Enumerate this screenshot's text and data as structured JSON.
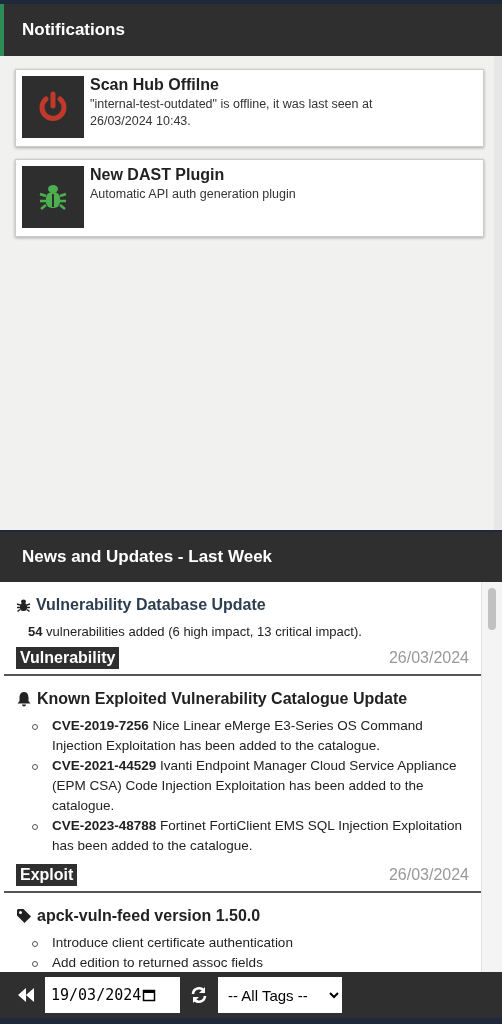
{
  "notifications": {
    "title": "Notifications",
    "items": [
      {
        "kind": "power",
        "title": "Scan Hub Offilne",
        "message": "\"internal-test-outdated\" is offline, it was last seen at 26/03/2024 10:43."
      },
      {
        "kind": "bug",
        "title": "New DAST Plugin",
        "message": "Automatic API auth generation plugin"
      }
    ]
  },
  "news": {
    "title": "News and Updates - Last Week",
    "items": [
      {
        "kind": "bug",
        "link": true,
        "title": "Vulnerability Database Update",
        "text": "**54** vulnerabilities added (6 high impact, 13 critical impact).",
        "tag": "Vulnerability",
        "date": "26/03/2024"
      },
      {
        "kind": "bell",
        "link": false,
        "title": "Known Exploited Vulnerability Catalogue Update",
        "bullets": [
          "**CVE-2019-7256** Nice Linear eMerge E3-Series OS Command Injection Exploitation has been added to the catalogue.",
          "**CVE-2021-44529** Ivanti Endpoint Manager Cloud Service Appliance (EPM CSA) Code Injection Exploitation has been added to the catalogue.",
          "**CVE-2023-48788** Fortinet FortiClient EMS SQL Injection Exploitation has been added to the catalogue."
        ],
        "tag": "Exploit",
        "date": "26/03/2024"
      },
      {
        "kind": "tag",
        "link": false,
        "title": "apck-vuln-feed version 1.50.0",
        "bullets": [
          "Introduce client certificate authentication",
          "Add edition to returned assoc fields"
        ]
      }
    ]
  },
  "footer": {
    "date": "19/03/2024",
    "tag_filter": "-- All Tags --"
  }
}
